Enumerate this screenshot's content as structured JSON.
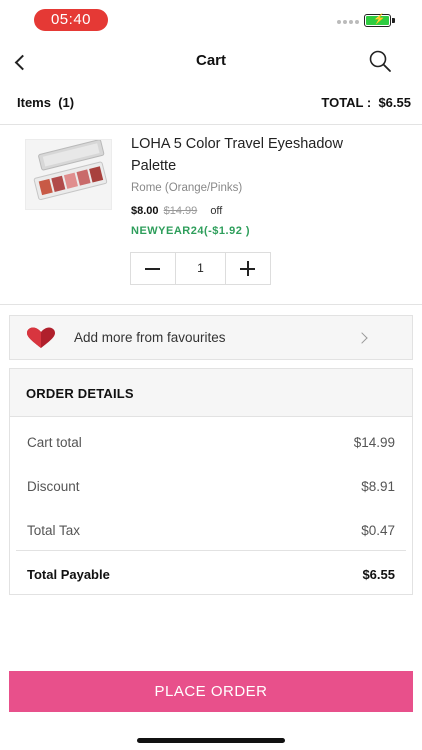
{
  "status_bar": {
    "time": "05:40",
    "time_pill_color": "#e53935",
    "battery_color": "#2ecc40"
  },
  "header": {
    "title": "Cart",
    "back_icon": "chevron-left-icon",
    "search_icon": "search-icon"
  },
  "summary": {
    "items_label": "Items",
    "items_count": "(1)",
    "total_label": "TOTAL :",
    "total_value": "$6.55"
  },
  "product": {
    "name": "LOHA 5 Color Travel Eyeshadow Palette",
    "variant": "Rome (Orange/Pinks)",
    "price": "$8.00",
    "original_price": "$14.99",
    "off_label": "off",
    "coupon": "NEWYEAR24(-$1.92 )",
    "coupon_color": "#2e9e5b",
    "quantity": "1"
  },
  "favourites": {
    "label": "Add more from favourites",
    "icon": "heart-icon"
  },
  "order_details": {
    "title": "ORDER DETAILS",
    "lines": [
      {
        "label": "Cart total",
        "value": "$14.99"
      },
      {
        "label": "Discount",
        "value": "$8.91"
      },
      {
        "label": "Total Tax",
        "value": "$0.47"
      }
    ],
    "payable_label": "Total Payable",
    "payable_value": "$6.55"
  },
  "cta": {
    "label": "PLACE ORDER",
    "color": "#e8508b"
  }
}
